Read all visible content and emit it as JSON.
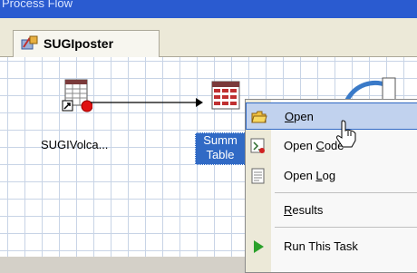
{
  "window": {
    "title": "Process Flow"
  },
  "tabs": [
    {
      "label": "SUGIposter",
      "icon": "process-flow-icon"
    }
  ],
  "nodes": [
    {
      "label": "SUGIVolca...",
      "icon": "data-table-icon"
    },
    {
      "label_line1": "Summ",
      "label_line2": "Table",
      "icon": "summary-table-icon"
    }
  ],
  "context_menu": {
    "items": [
      {
        "label": "Open",
        "accel": "O",
        "icon": "folder-open-icon",
        "selected": true
      },
      {
        "label": "Open Code",
        "accel": "C",
        "icon": "code-icon"
      },
      {
        "label": "Open Log",
        "accel": "L",
        "icon": "log-icon"
      },
      {
        "label": "Results",
        "accel": "R"
      },
      {
        "label": "Run This Task",
        "icon": "run-icon"
      }
    ]
  },
  "colors": {
    "titlebar": "#2a5bd0",
    "selection": "#316ac5",
    "menu_highlight": "#c1d2ee"
  }
}
